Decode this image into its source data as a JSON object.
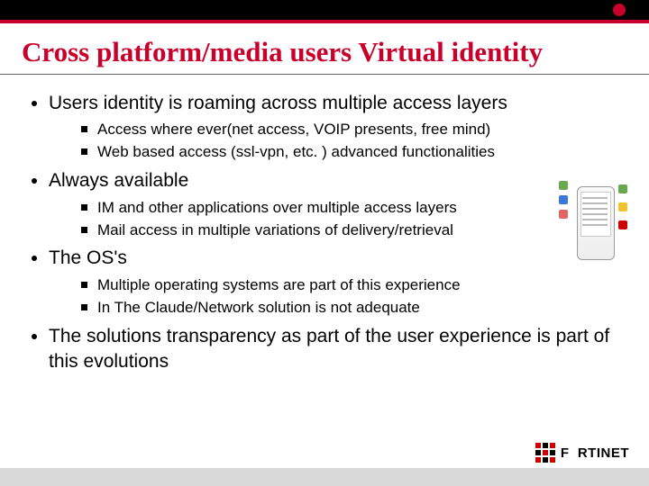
{
  "title": "Cross platform/media users Virtual identity",
  "bullets": [
    {
      "text": "Users identity is roaming across multiple access layers",
      "sub": [
        "Access where ever(net access, VOIP presents, free mind)",
        "Web based access (ssl-vpn, etc. ) advanced functionalities"
      ]
    },
    {
      "text": "Always available",
      "sub": [
        "IM and other applications over multiple access layers",
        "Mail access in multiple variations of delivery/retrieval"
      ]
    },
    {
      "text": "The OS's",
      "sub": [
        "Multiple operating systems are part of this experience",
        "In The Claude/Network solution is not adequate"
      ]
    },
    {
      "text": "The solutions transparency as part of the user experience is part of this evolutions",
      "sub": []
    }
  ],
  "logo_text": "F  RTINET"
}
